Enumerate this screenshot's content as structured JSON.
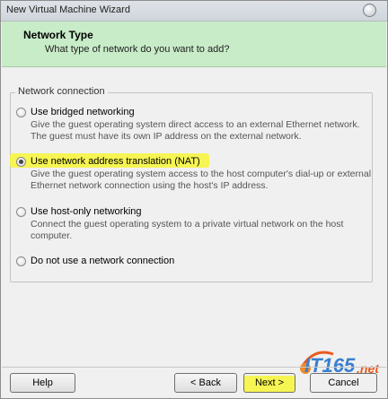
{
  "window": {
    "title": "New Virtual Machine Wizard"
  },
  "header": {
    "title": "Network Type",
    "subtitle": "What type of network do you want to add?"
  },
  "group": {
    "label": "Network connection",
    "options": [
      {
        "label": "Use bridged networking",
        "description": "Give the guest operating system direct access to an external Ethernet network. The guest must have its own IP address on the external network.",
        "checked": false
      },
      {
        "label": "Use network address translation (NAT)",
        "description": "Give the guest operating system access to the host computer's dial-up or external Ethernet network connection using the host's IP address.",
        "checked": true
      },
      {
        "label": "Use host-only networking",
        "description": "Connect the guest operating system to a private virtual network on the host computer.",
        "checked": false
      },
      {
        "label": "Do not use a network connection",
        "description": "",
        "checked": false
      }
    ]
  },
  "buttons": {
    "help": "Help",
    "back": "< Back",
    "next": "Next >",
    "cancel": "Cancel"
  },
  "watermark": {
    "brand": "IT165",
    "suffix": ".net"
  },
  "colors": {
    "header_bg": "#c8ebc8",
    "highlight": "#f6f541"
  }
}
